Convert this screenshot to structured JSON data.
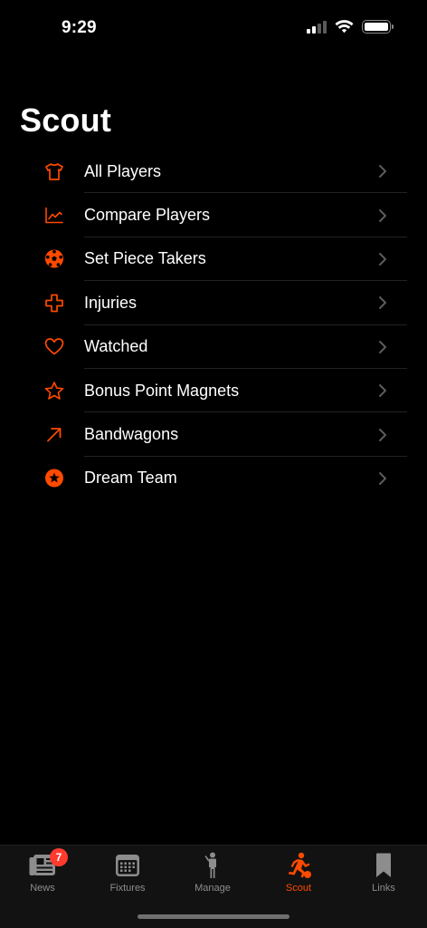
{
  "status_bar": {
    "time": "9:29"
  },
  "page_title": "Scout",
  "menu": [
    {
      "label": "All Players",
      "icon": "shirt-icon"
    },
    {
      "label": "Compare Players",
      "icon": "chart-line-icon"
    },
    {
      "label": "Set Piece Takers",
      "icon": "soccer-ball-icon"
    },
    {
      "label": "Injuries",
      "icon": "medical-cross-icon"
    },
    {
      "label": "Watched",
      "icon": "heart-icon"
    },
    {
      "label": "Bonus Point Magnets",
      "icon": "star-icon"
    },
    {
      "label": "Bandwagons",
      "icon": "arrow-up-right-icon"
    },
    {
      "label": "Dream Team",
      "icon": "star-circle-icon"
    }
  ],
  "tabs": [
    {
      "label": "News",
      "icon": "newspaper-icon",
      "badge": "7"
    },
    {
      "label": "Fixtures",
      "icon": "calendar-icon"
    },
    {
      "label": "Manage",
      "icon": "person-standing-icon"
    },
    {
      "label": "Scout",
      "icon": "runner-ball-icon",
      "active": true
    },
    {
      "label": "Links",
      "icon": "bookmark-icon"
    }
  ],
  "colors": {
    "accent": "#ff4a00",
    "background": "#000000",
    "tab_inactive": "#8d8d8d",
    "badge": "#ff3b30"
  }
}
